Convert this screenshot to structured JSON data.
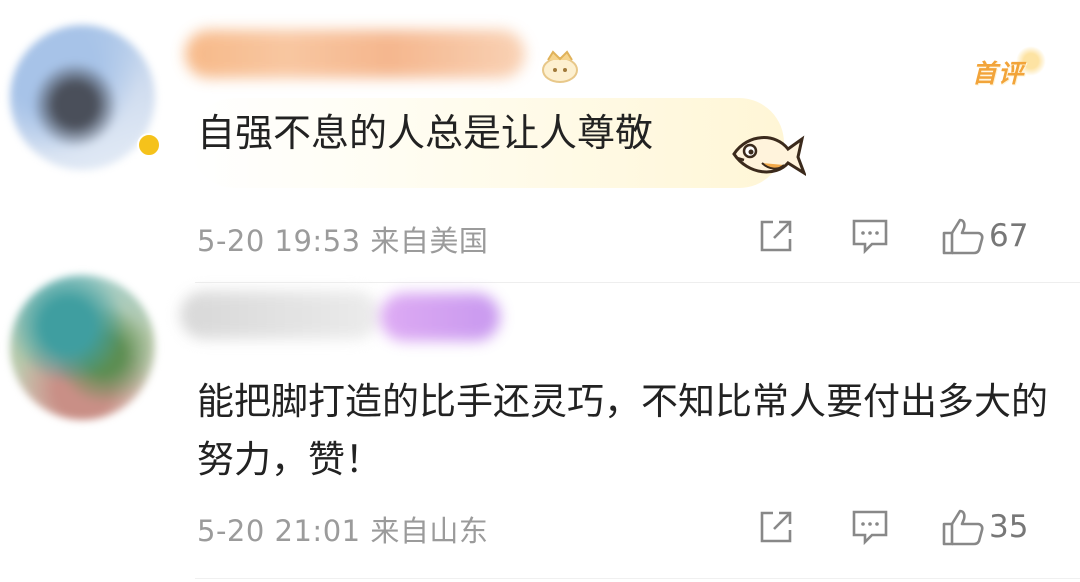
{
  "comments": [
    {
      "text": "自强不息的人总是让人尊敬",
      "meta": "5-20 19:53 来自美国",
      "first_label": "首评",
      "likes": "67",
      "icons": [
        "share-icon",
        "comment-icon",
        "thumbs-up-icon"
      ]
    },
    {
      "text": "能把脚打造的比手还灵巧，不知比常人要付出多大的努力，赞！",
      "meta": "5-20 21:01 来自山东",
      "likes": "35",
      "icons": [
        "share-icon",
        "comment-icon",
        "thumbs-up-icon"
      ]
    }
  ],
  "colors": {
    "first_tag": "#f2a43a",
    "meta_text": "#9b9b9b",
    "icon_stroke": "#888888"
  }
}
